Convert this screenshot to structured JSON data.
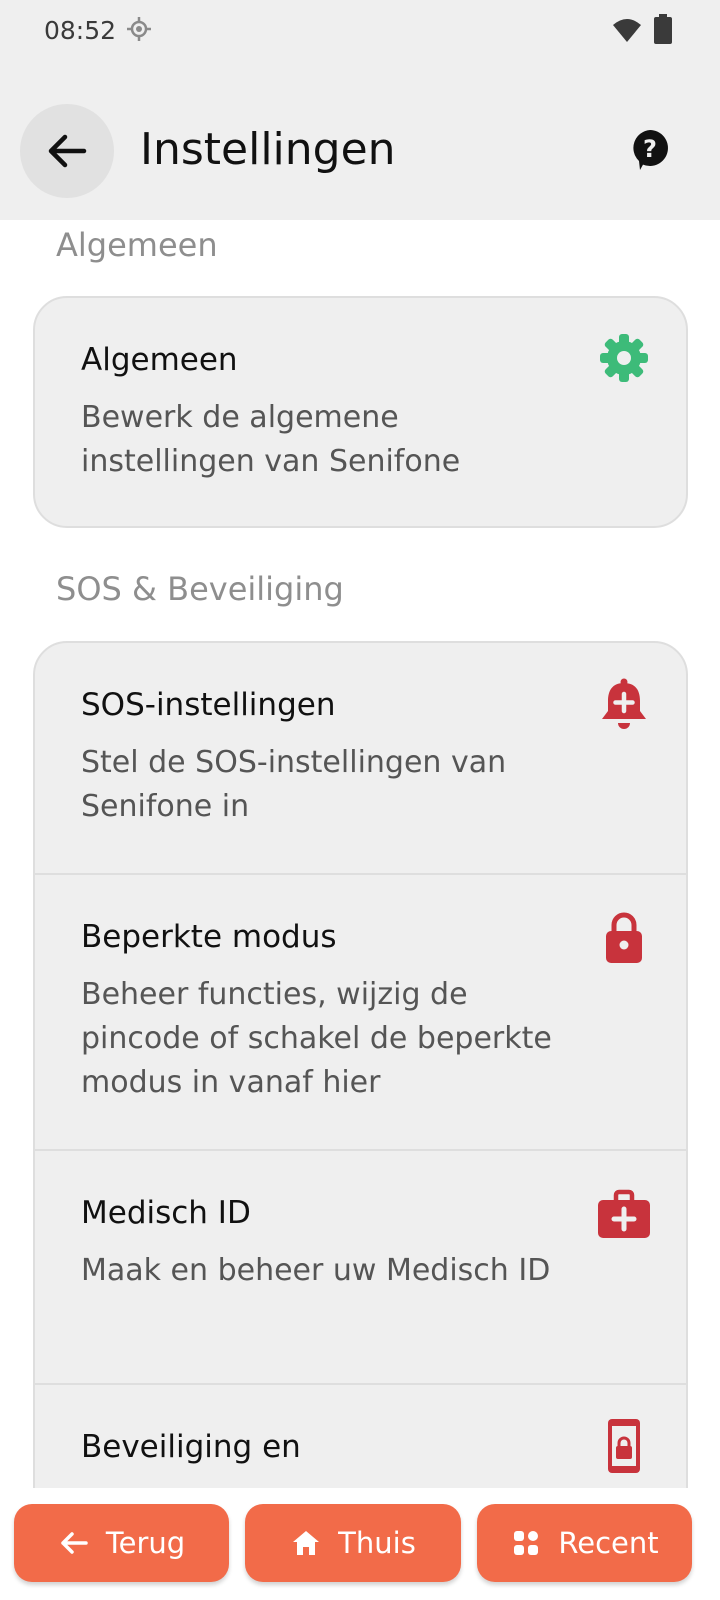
{
  "status_bar": {
    "time": "08:52"
  },
  "header": {
    "title": "Instellingen"
  },
  "sections": [
    {
      "title": "Algemeen",
      "items": [
        {
          "title": "Algemeen",
          "subtitle": "Bewerk de algemene instellingen van Senifone",
          "icon": "gear-icon",
          "icon_color": "#3dbb79"
        }
      ]
    },
    {
      "title": "SOS & Beveiliging",
      "items": [
        {
          "title": "SOS-instellingen",
          "subtitle": "Stel de SOS-instellingen van Senifone in",
          "icon": "alarm-bell-plus-icon",
          "icon_color": "#c8333c"
        },
        {
          "title": "Beperkte modus",
          "subtitle": "Beheer functies, wijzig de pincode of schakel de beperkte modus in vanaf hier",
          "icon": "lock-icon",
          "icon_color": "#c8333c"
        },
        {
          "title": "Medisch ID",
          "subtitle": "Maak en beheer uw Medisch ID",
          "icon": "medical-kit-icon",
          "icon_color": "#c8333c"
        },
        {
          "title": "Beveiliging en",
          "subtitle": "",
          "icon": "phone-lock-icon",
          "icon_color": "#c8333c"
        }
      ]
    }
  ],
  "bottom_nav": {
    "back": "Terug",
    "home": "Thuis",
    "recent": "Recent"
  },
  "colors": {
    "accent": "#f26b49",
    "sos_red": "#c8333c",
    "general_green": "#3dbb79"
  }
}
